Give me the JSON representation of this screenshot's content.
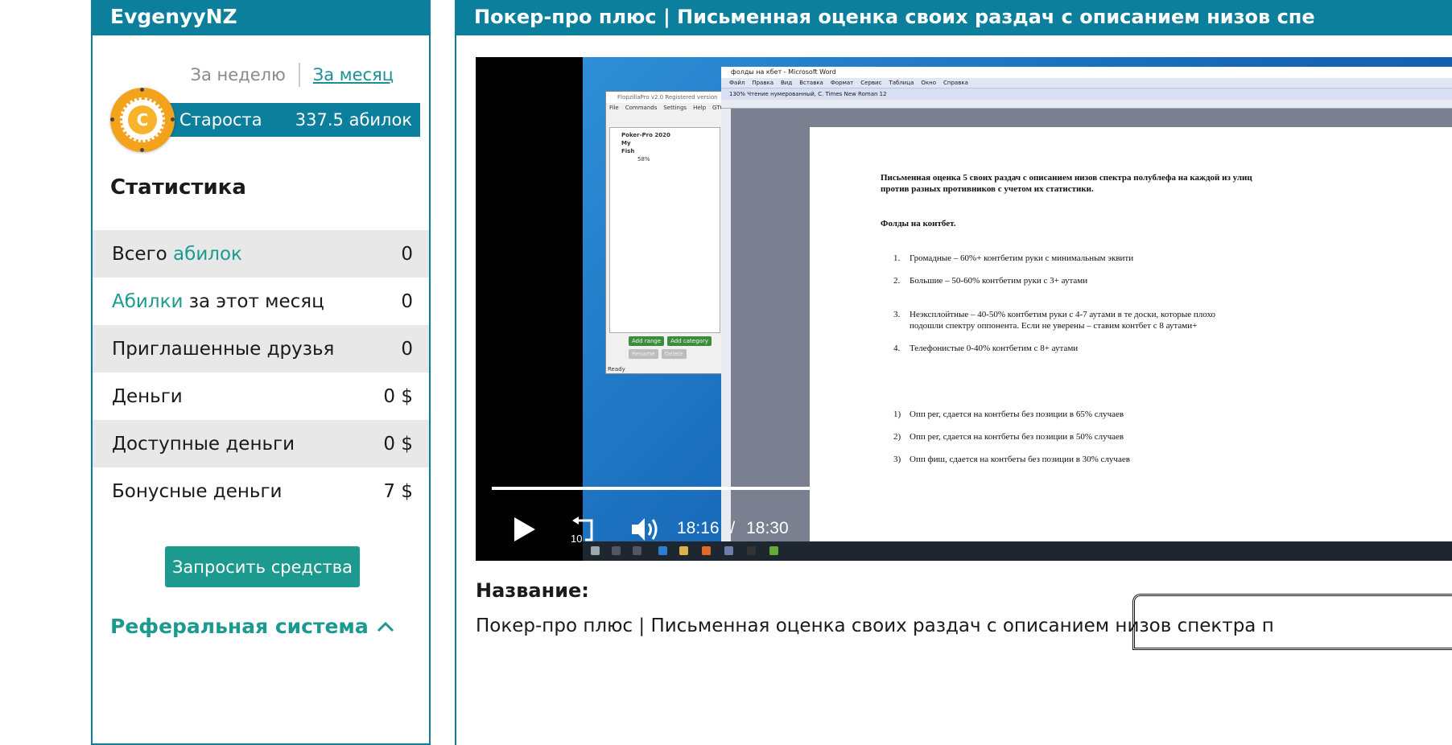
{
  "profile": {
    "username": "EvgenyyNZ",
    "period_week": "За неделю",
    "period_month": "За месяц",
    "chip_letter": "C",
    "rank": "Староста",
    "points": "337.5 абилок"
  },
  "stats": {
    "title": "Статистика",
    "rows": [
      {
        "label_a": "Всего ",
        "label_accent": "абилок",
        "label_b": "",
        "value": "0"
      },
      {
        "label_a": "",
        "label_accent": "Абилки",
        "label_b": " за этот месяц",
        "value": "0"
      },
      {
        "label_a": "Приглашенные друзья",
        "label_accent": "",
        "label_b": "",
        "value": "0"
      },
      {
        "label_a": "Деньги",
        "label_accent": "",
        "label_b": "",
        "value": "0 $"
      },
      {
        "label_a": "Доступные деньги",
        "label_accent": "",
        "label_b": "",
        "value": "0 $"
      },
      {
        "label_a": "Бонусные деньги",
        "label_accent": "",
        "label_b": "",
        "value": "7 $"
      }
    ],
    "request_button": "Запросить средства",
    "referral": "Реферальная система"
  },
  "video": {
    "header": "Покер-про плюс | Письменная оценка своих раздач с описанием низов спе",
    "current_time": "18:16",
    "separator": "/",
    "duration": "18:30",
    "rewind_seconds": "10",
    "progress": 0.98,
    "flopzilla": {
      "title": "FlopzillaPro v2.0 Registered version",
      "menu": [
        "File",
        "Commands",
        "Settings",
        "Help",
        "GTO"
      ],
      "tree": [
        "Poker-Pro 2020",
        "My",
        "Fish",
        "58%"
      ],
      "buttons": [
        "Add range",
        "Add category",
        "Rename",
        "Delete"
      ],
      "status": "Ready"
    },
    "word": {
      "title": "фолды на кбет - Microsoft Word",
      "menu": [
        "Файл",
        "Правка",
        "Вид",
        "Вставка",
        "Формат",
        "Сервис",
        "Таблица",
        "Окно",
        "Справка"
      ],
      "toolbar": "130%   Чтение   нумерованный, С.   Times New Roman   12",
      "heading": "Письменная оценка 5 своих раздач с описанием низов спектра полублефа на каждой из улиц против разных противников с учетом их статистики.",
      "subheading": "Фолды на контбет.",
      "items": [
        {
          "n": "1.",
          "text": "Громадные – 60%+              контбетим руки с минимальным эквити"
        },
        {
          "n": "2.",
          "text": "Большие – 50-60%              контбетим руки с 3+ аутами"
        },
        {
          "n": "3.",
          "text": "Неэксплойтные – 40-50%    контбетим руки с 4-7 аутами в те доски, которые плохо"
        },
        {
          "n": "",
          "text": "подошли спектру оппонента. Если не уверены – ставим контбет с 8 аутами+"
        },
        {
          "n": "4.",
          "text": "Телефонистые 0-40%            контбетим с 8+ аутами"
        },
        {
          "n": "1)",
          "text": "Опп рег, сдается на контбеты без позиции в 65% случаев"
        },
        {
          "n": "2)",
          "text": "Опп рег, сдается на контбеты без позиции в 50% случаев"
        },
        {
          "n": "3)",
          "text": "Опп фиш, сдается на контбеты без позиции в 30% случаев"
        }
      ]
    }
  },
  "details": {
    "name_label": "Название:",
    "name_value": "Покер-про плюс | Письменная оценка своих раздач с описанием низов спектра п"
  },
  "colors": {
    "brand": "#0b7f9b",
    "accent": "#1d9a8f",
    "chip": "#f3a21b"
  }
}
